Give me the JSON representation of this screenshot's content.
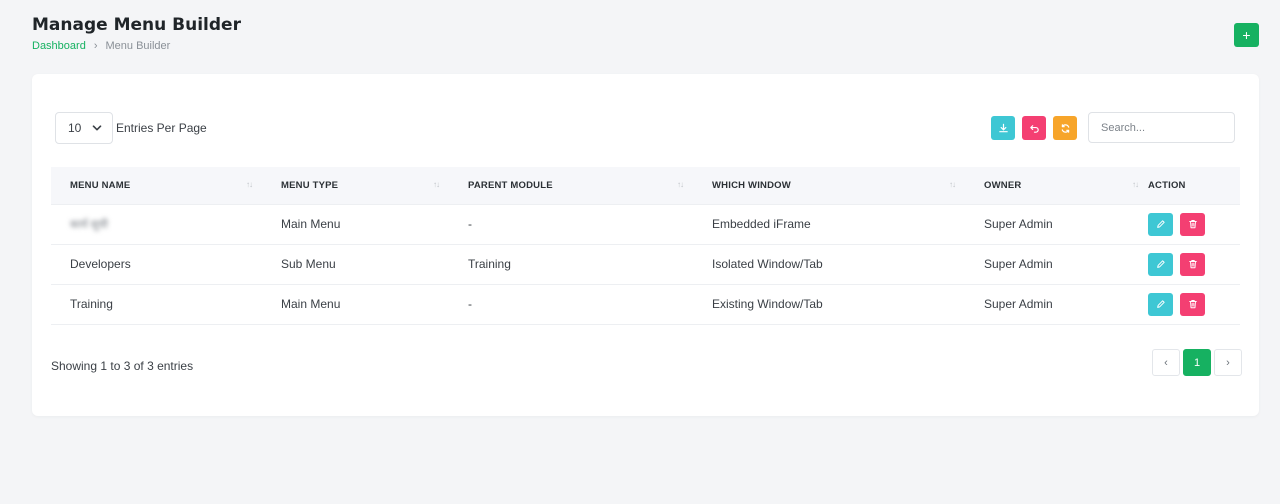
{
  "header": {
    "title": "Manage Menu Builder",
    "breadcrumb": {
      "home": "Dashboard",
      "separator": "›",
      "current": "Menu Builder"
    },
    "add_label": "+"
  },
  "toolbar": {
    "per_page_value": "10",
    "per_page_label": "Entries Per Page",
    "search_placeholder": "Search...",
    "buttons": [
      "download-icon",
      "undo-icon",
      "refresh-icon"
    ]
  },
  "table": {
    "columns": [
      "MENU NAME",
      "MENU TYPE",
      "PARENT MODULE",
      "WHICH WINDOW",
      "OWNER",
      "ACTION"
    ],
    "sort_glyph": "↑↓",
    "rows": [
      {
        "menu_name": "कार्य सूची",
        "menu_type": "Main Menu",
        "parent_module": "-",
        "which_window": "Embedded iFrame",
        "owner": "Super Admin"
      },
      {
        "menu_name": "Developers",
        "menu_type": "Sub Menu",
        "parent_module": "Training",
        "which_window": "Isolated Window/Tab",
        "owner": "Super Admin"
      },
      {
        "menu_name": "Training",
        "menu_type": "Main Menu",
        "parent_module": "-",
        "which_window": "Existing Window/Tab",
        "owner": "Super Admin"
      }
    ]
  },
  "footer": {
    "info": "Showing 1 to 3 of 3 entries",
    "pagination": {
      "prev": "‹",
      "current": "1",
      "next": "›"
    }
  },
  "colors": {
    "primary": "#16b161",
    "info": "#3ec7d4",
    "danger": "#f43f72",
    "warning": "#f7a52a"
  }
}
